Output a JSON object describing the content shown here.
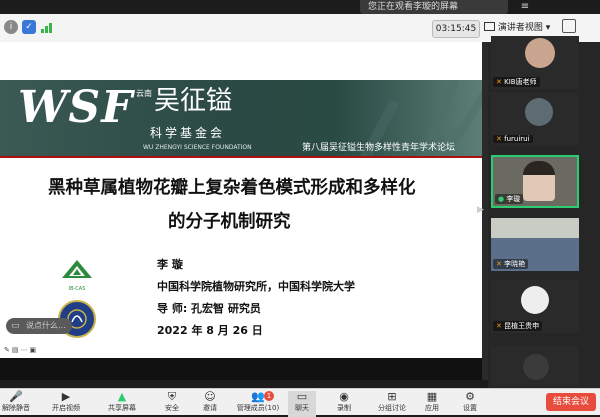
{
  "share_banner": {
    "text": "您正在观看李璇的屏幕",
    "menu_icon": "≡"
  },
  "topbar": {
    "timer": "03:15:45",
    "view_button": "演讲者视图",
    "view_caret": "▾"
  },
  "slide": {
    "banner_logo": "WSF",
    "banner_org_cn": "吴征镒",
    "banner_org_small": "云南",
    "banner_org_sub": "科学基金会",
    "banner_org_en": "WU ZHENGYI SCIENCE FOUNDATION",
    "banner_forum": "第八届吴征镒生物多样性青年学术论坛",
    "title_line1": "黑种草属植物花瓣上复杂着色模式形成和多样化",
    "title_line2": "的分子机制研究",
    "author": "李 璇",
    "affiliation": "中国科学院植物研究所，中国科学院大学",
    "advisor": "导 师:  孔宏智 研究员",
    "date": "2022 年 8 月 26 日",
    "ib_logo_caption": "IB-CAS"
  },
  "comment_box": {
    "placeholder": "说点什么..."
  },
  "participants": [
    {
      "name": "KIB唐老师"
    },
    {
      "name": "furuirui"
    },
    {
      "name": "李璇"
    },
    {
      "name": "李晓艳"
    },
    {
      "name": "昆植王贵申"
    },
    {
      "name": ""
    }
  ],
  "toolbar": {
    "items": [
      {
        "label": "解除静音",
        "icon": "mic-icon"
      },
      {
        "label": "开启视频",
        "icon": "video-icon"
      },
      {
        "label": "共享屏幕",
        "icon": "share-screen-icon"
      },
      {
        "label": "安全",
        "icon": "shield-icon"
      },
      {
        "label": "邀请",
        "icon": "invite-icon"
      },
      {
        "label": "管理成员(10)",
        "icon": "members-icon",
        "badge": "1"
      },
      {
        "label": "聊天",
        "icon": "chat-icon"
      },
      {
        "label": "录制",
        "icon": "record-icon"
      },
      {
        "label": "分组讨论",
        "icon": "breakout-icon"
      },
      {
        "label": "应用",
        "icon": "apps-icon"
      },
      {
        "label": "设置",
        "icon": "gear-icon"
      }
    ],
    "leave_button": "结束会议"
  },
  "colors": {
    "banner_green": "#2f4a45",
    "leave_red": "#e74c3c",
    "slide_red_line": "#aa1111"
  }
}
